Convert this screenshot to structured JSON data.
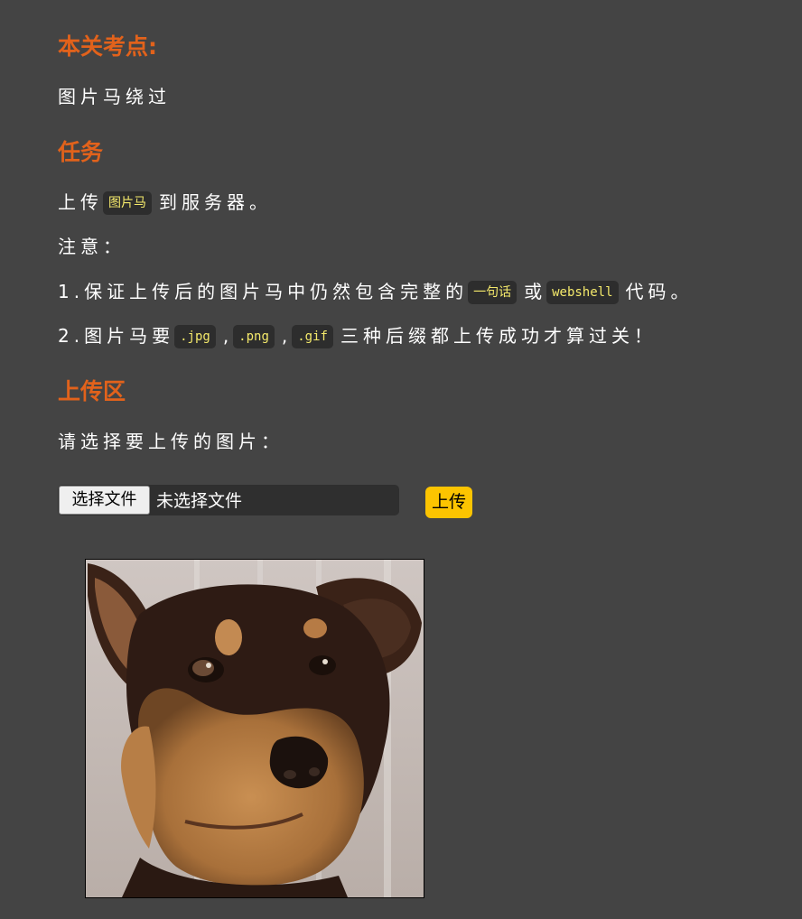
{
  "sections": {
    "points_title": "本关考点:",
    "points_text": "图片马绕过",
    "task_title": "任务",
    "upload_title": "上传区"
  },
  "task": {
    "line1_prefix": "上传",
    "line1_code": "图片马",
    "line1_suffix": "到服务器。",
    "note_label": "注意：",
    "item1_prefix": "1.保证上传后的图片马中仍然包含完整的",
    "item1_code1": "一句话",
    "item1_mid": "或",
    "item1_code2": "webshell",
    "item1_suffix": "代码。",
    "item2_prefix": "2.图片马要",
    "item2_code1": ".jpg",
    "item2_sep1": ",",
    "item2_code2": ".png",
    "item2_sep2": ",",
    "item2_code3": ".gif",
    "item2_suffix": "三种后缀都上传成功才算过关！"
  },
  "upload": {
    "prompt": "请选择要上传的图片：",
    "choose_button": "选择文件",
    "no_file_text": "未选择文件",
    "submit_button": "上传"
  },
  "colors": {
    "background": "#444444",
    "heading": "#e2621b",
    "code_bg": "#2d2d2d",
    "code_text": "#f4e96b",
    "upload_button": "#fcc400"
  }
}
